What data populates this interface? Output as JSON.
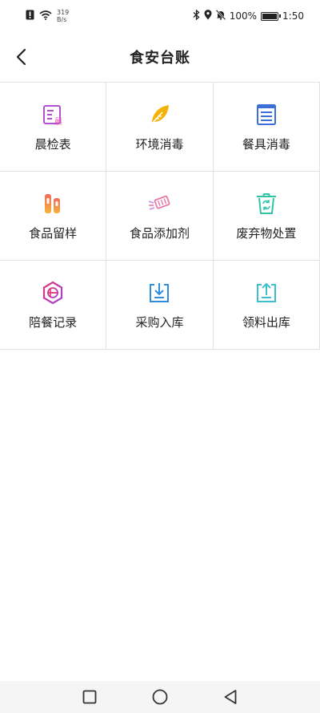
{
  "status_bar": {
    "net_speed_value": "319",
    "net_speed_unit": "B/s",
    "battery_percent": "100%",
    "battery_level": 1.0,
    "time": "1:50"
  },
  "header": {
    "title": "食安台账"
  },
  "grid": {
    "items": [
      {
        "label": "晨检表",
        "icon": "morning-check-icon",
        "color": "#b34fd1"
      },
      {
        "label": "环境消毒",
        "icon": "leaf-icon",
        "color": "#f5b20a"
      },
      {
        "label": "餐具消毒",
        "icon": "cabinet-icon",
        "color": "#3a6fd8"
      },
      {
        "label": "食品留样",
        "icon": "sample-tubes-icon",
        "color": "#f06b4f"
      },
      {
        "label": "食品添加剂",
        "icon": "additive-icon",
        "color": "#e87aa8"
      },
      {
        "label": "废弃物处置",
        "icon": "recycle-bin-icon",
        "color": "#2ec4a6"
      },
      {
        "label": "陪餐记录",
        "icon": "meal-record-icon",
        "color": "#e0367a"
      },
      {
        "label": "采购入库",
        "icon": "download-tray-icon",
        "color": "#2f8de0"
      },
      {
        "label": "领料出库",
        "icon": "upload-tray-icon",
        "color": "#3cc0d0"
      }
    ]
  }
}
